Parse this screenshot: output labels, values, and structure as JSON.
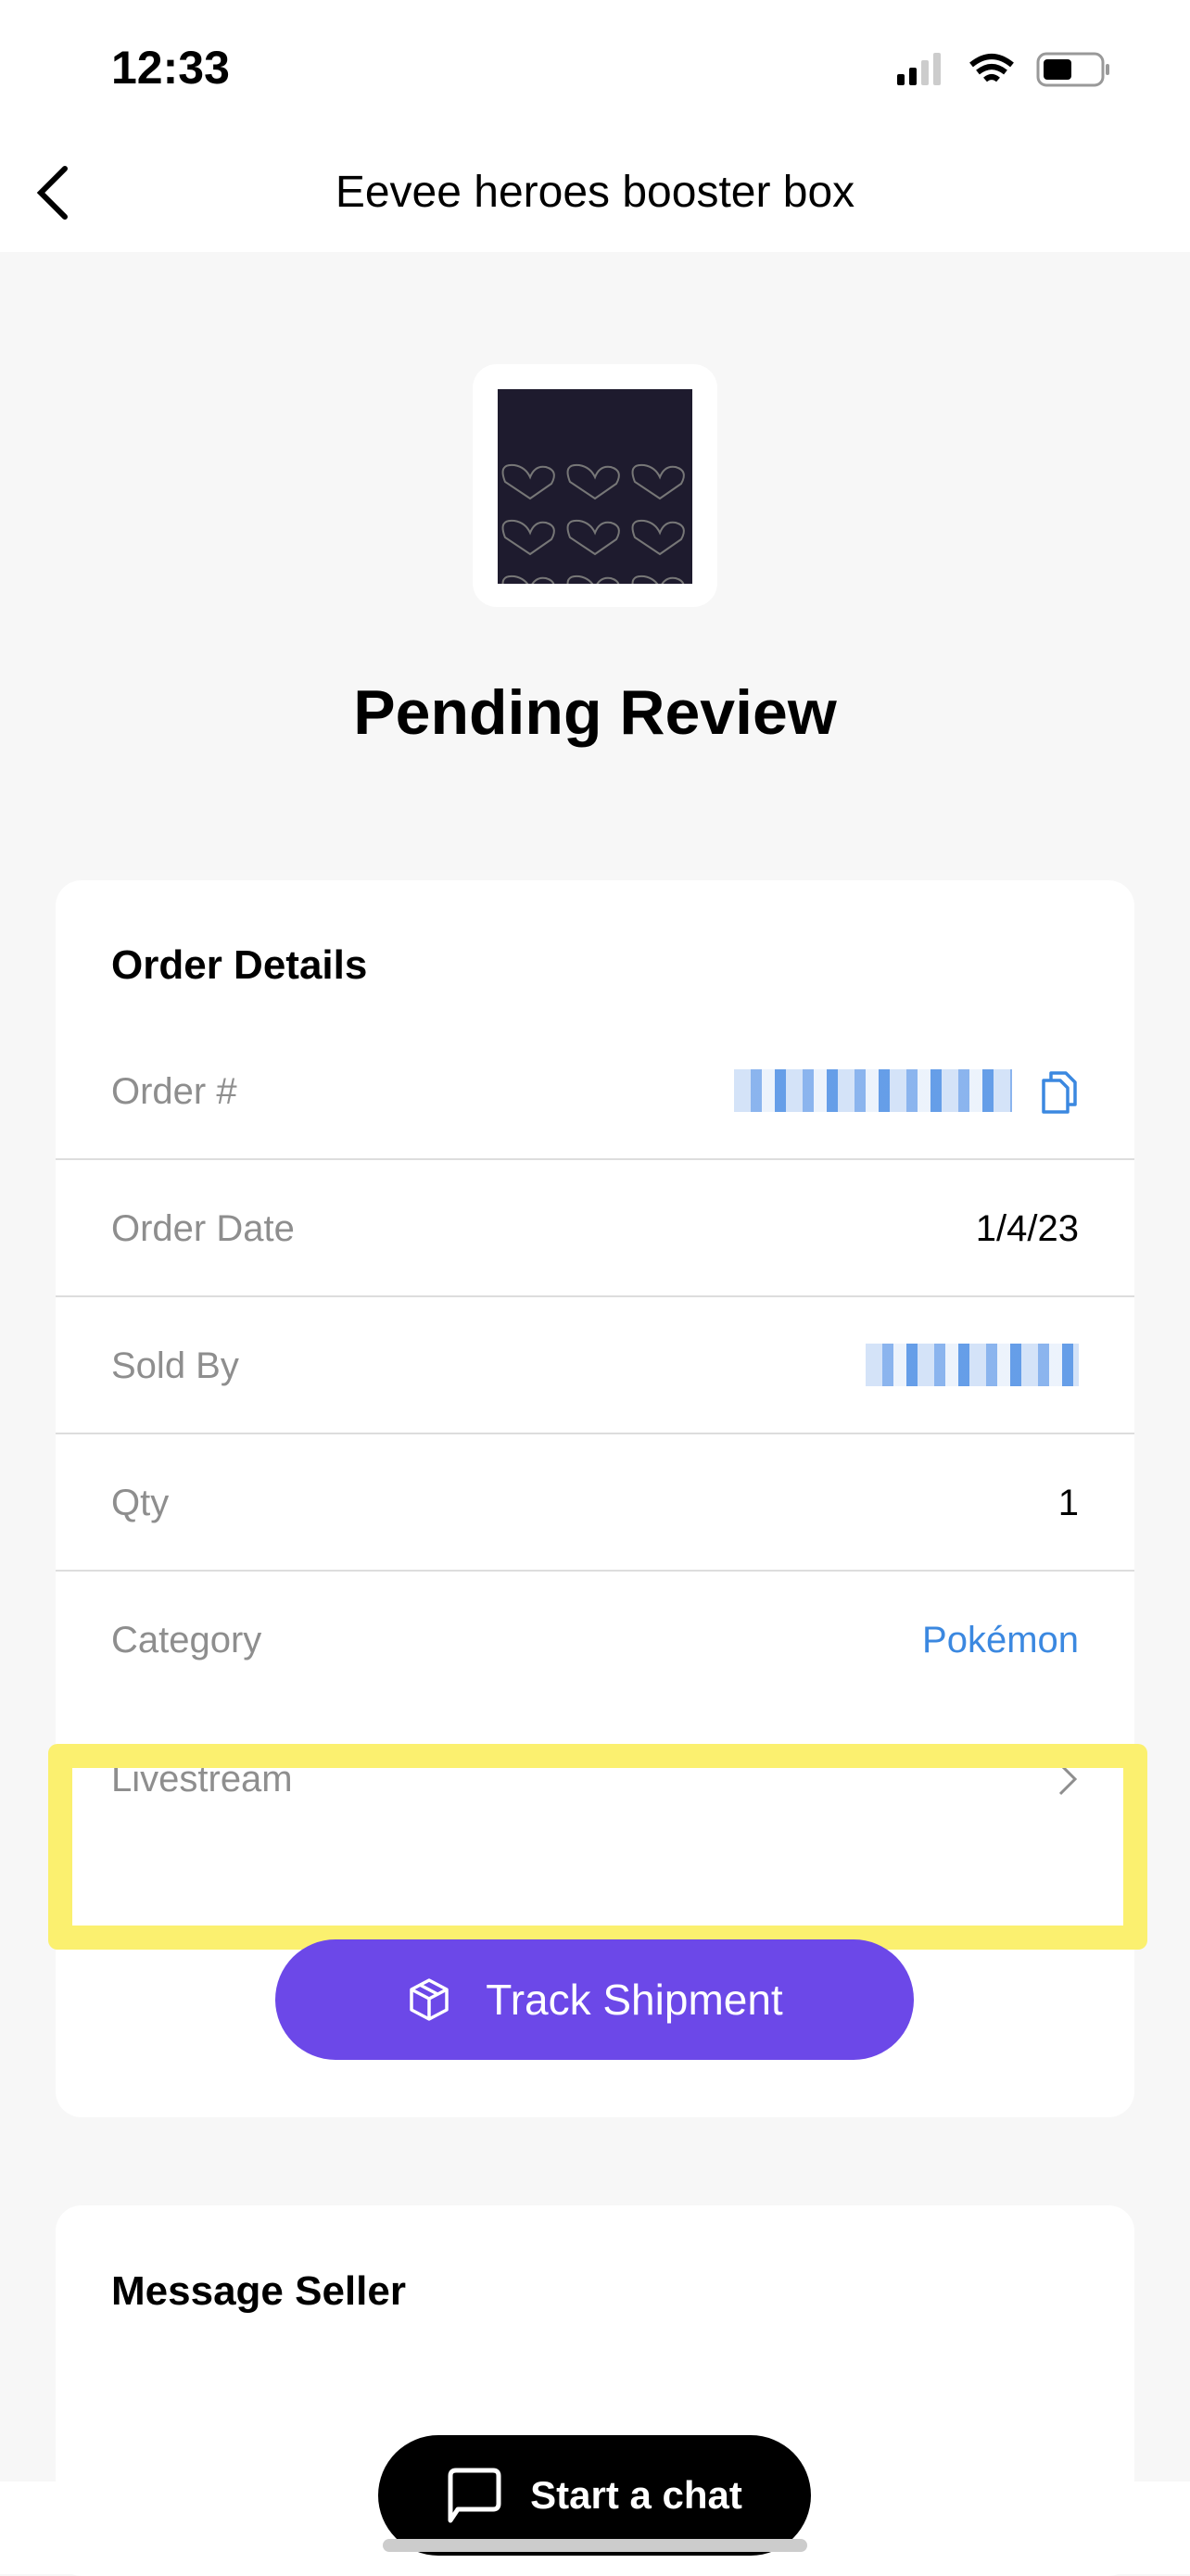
{
  "status_bar": {
    "time": "12:33",
    "icons": [
      "signal-icon",
      "wifi-icon",
      "battery-icon"
    ]
  },
  "nav": {
    "title": "Eevee heroes booster box",
    "back_icon": "chevron-left-icon"
  },
  "status_title": "Pending Review",
  "order_details": {
    "heading": "Order Details",
    "rows": [
      {
        "label": "Order #",
        "value": ""
      },
      {
        "label": "Order Date",
        "value": "1/4/23"
      },
      {
        "label": "Sold By",
        "value": ""
      },
      {
        "label": "Qty",
        "value": "1"
      },
      {
        "label": "Category",
        "value": "Pokémon"
      },
      {
        "label": "Livestream",
        "value": ""
      }
    ],
    "track_button": "Track Shipment"
  },
  "message_seller": {
    "heading": "Message Seller",
    "chat_button": "Start a chat"
  },
  "colors": {
    "accent": "#6c48e8",
    "link": "#3b88e0",
    "highlight": "#fbf06f"
  }
}
